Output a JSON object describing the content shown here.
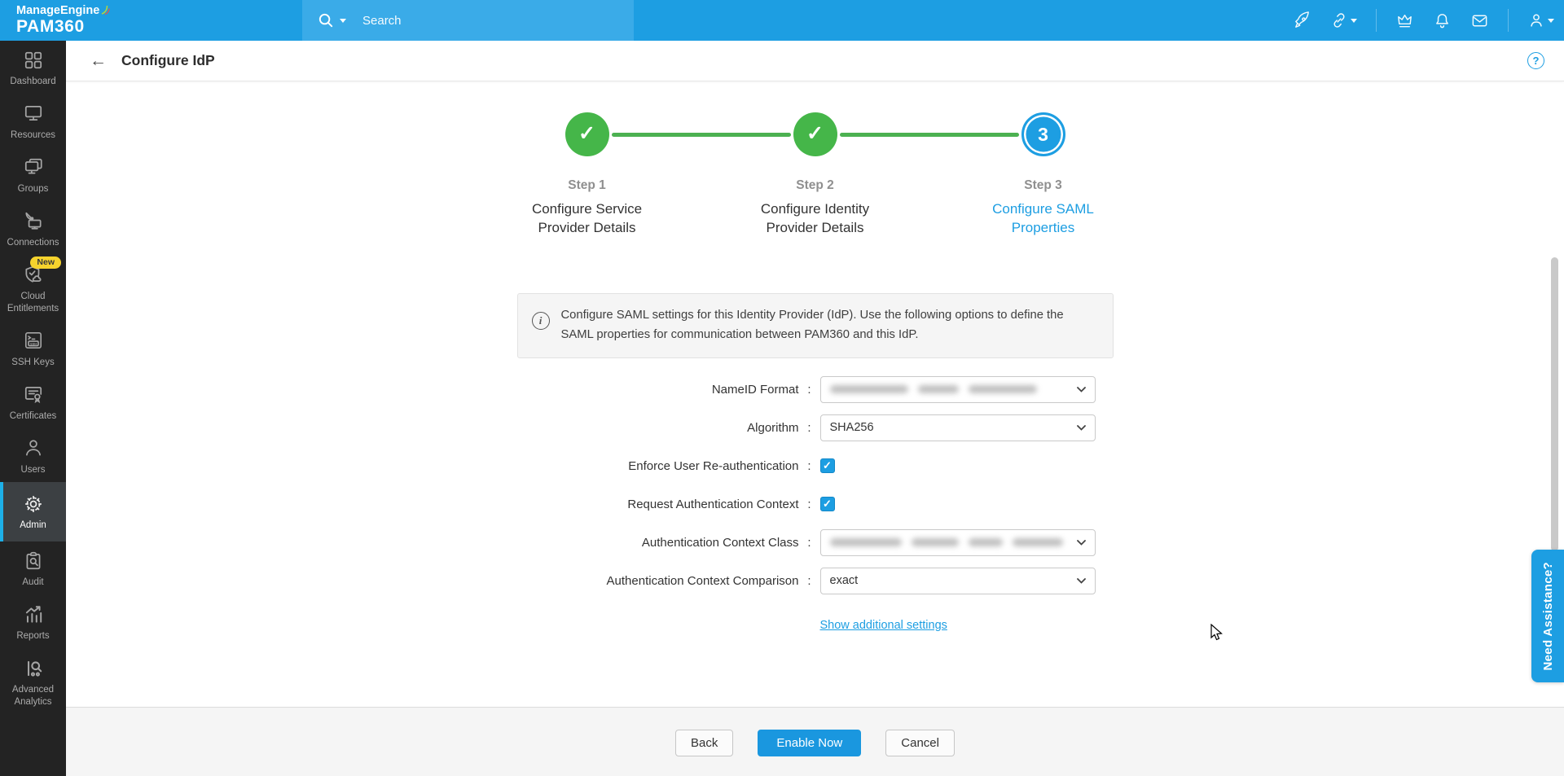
{
  "brand": {
    "line1": "ManageEngine",
    "line2": "PAM360"
  },
  "topbar": {
    "search_placeholder": "Search",
    "icons": [
      "rocket-icon",
      "link-icon",
      "crown-icon",
      "bell-icon",
      "mail-icon",
      "user-icon"
    ]
  },
  "sidebar": {
    "items": [
      {
        "label": "Dashboard",
        "icon": "dashboard-icon",
        "selected": false
      },
      {
        "label": "Resources",
        "icon": "resources-icon",
        "selected": false
      },
      {
        "label": "Groups",
        "icon": "groups-icon",
        "selected": false
      },
      {
        "label": "Connections",
        "icon": "connections-icon",
        "selected": false
      },
      {
        "label": "Cloud Entitlements",
        "icon": "cloud-entitlements-icon",
        "selected": false,
        "badge": "New"
      },
      {
        "label": "SSH Keys",
        "icon": "ssh-keys-icon",
        "selected": false
      },
      {
        "label": "Certificates",
        "icon": "certificates-icon",
        "selected": false
      },
      {
        "label": "Users",
        "icon": "users-icon",
        "selected": false
      },
      {
        "label": "Admin",
        "icon": "admin-icon",
        "selected": true
      },
      {
        "label": "Audit",
        "icon": "audit-icon",
        "selected": false
      },
      {
        "label": "Reports",
        "icon": "reports-icon",
        "selected": false
      },
      {
        "label": "Advanced Analytics",
        "icon": "advanced-analytics-icon",
        "selected": false
      }
    ]
  },
  "header": {
    "title": "Configure IdP"
  },
  "stepper": {
    "steps": [
      {
        "step": "Step 1",
        "title": "Configure Service Provider Details",
        "state": "complete"
      },
      {
        "step": "Step 2",
        "title": "Configure Identity Provider Details",
        "state": "complete"
      },
      {
        "step": "Step 3",
        "title": "Configure SAML Properties",
        "state": "current",
        "number": "3"
      }
    ]
  },
  "info": {
    "text": "Configure SAML settings for this Identity Provider (IdP). Use the following options to define the SAML properties for communication between PAM360 and this IdP."
  },
  "form": {
    "colon": ":",
    "name_id_label": "NameID Format",
    "name_id_value_redacted": true,
    "algorithm_label": "Algorithm",
    "algorithm_value": "SHA256",
    "enforce_label": "Enforce User Re-authentication",
    "enforce_checked": true,
    "request_label": "Request Authentication Context",
    "request_checked": true,
    "context_class_label": "Authentication Context Class",
    "context_class_value_redacted": true,
    "comparison_label": "Authentication Context Comparison",
    "comparison_value": "exact",
    "additional_settings_link": "Show additional settings"
  },
  "footer": {
    "back": "Back",
    "enable": "Enable Now",
    "cancel": "Cancel"
  },
  "assistance": {
    "label": "Need Assistance?"
  },
  "glyphs": {
    "back_arrow": "←",
    "check": "✓",
    "question": "?",
    "info": "i"
  },
  "colors": {
    "accent_blue": "#1d9ee2",
    "search_blue": "#3aabe8",
    "success_green": "#45b649",
    "sidebar_bg": "#232323",
    "selected_bg": "#3c4043",
    "badge_yellow": "#f6d32d",
    "footer_bg": "#f5f5f5"
  }
}
